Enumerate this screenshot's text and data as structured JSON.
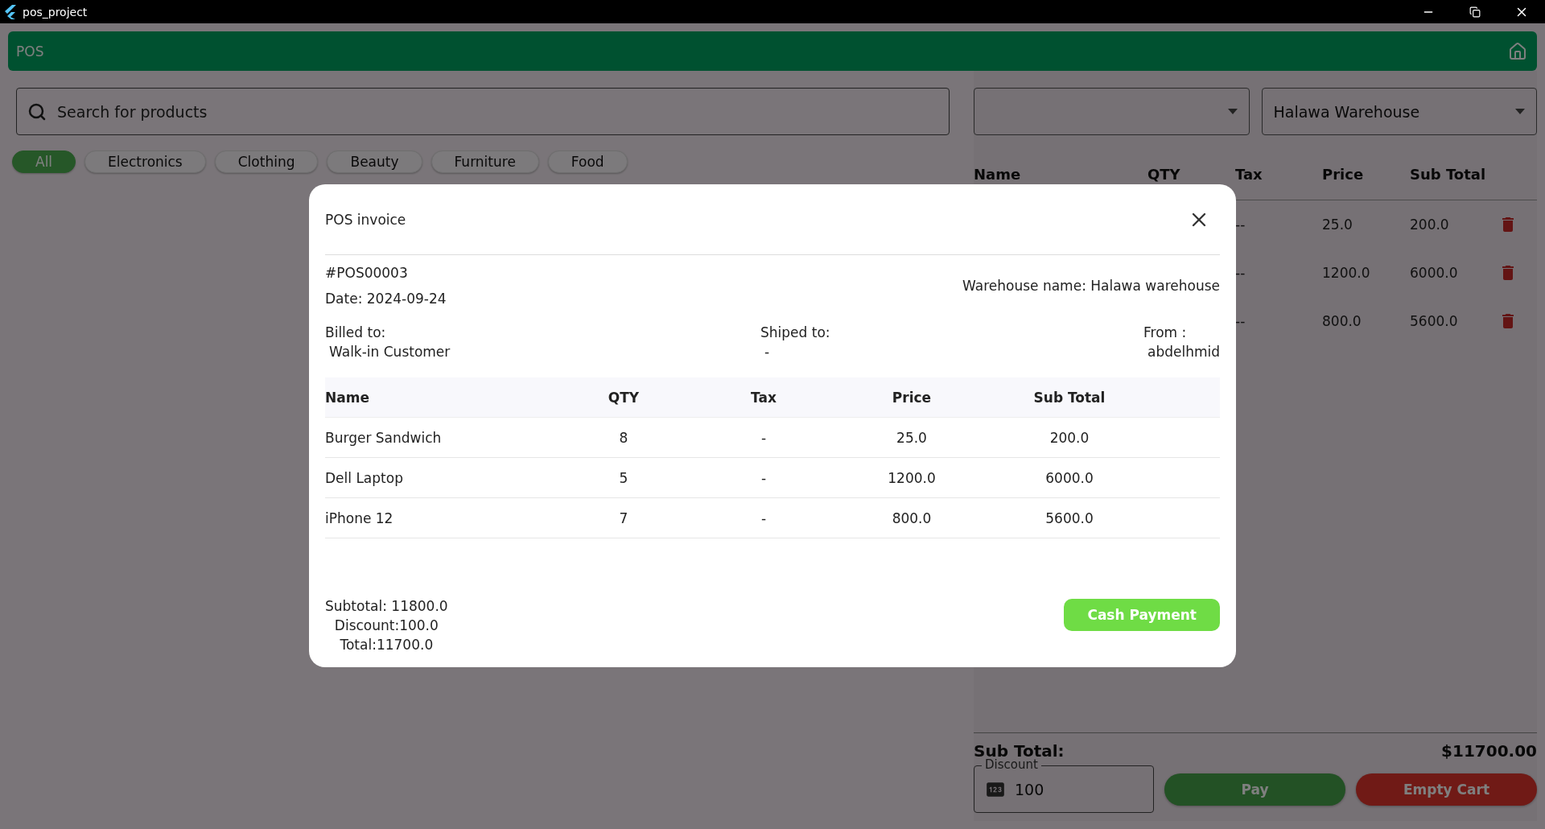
{
  "window": {
    "title": "pos_project"
  },
  "app_bar": {
    "title": "POS"
  },
  "search": {
    "placeholder": "Search for products"
  },
  "categories": [
    {
      "label": "All",
      "selected": true
    },
    {
      "label": "Electronics",
      "selected": false
    },
    {
      "label": "Clothing",
      "selected": false
    },
    {
      "label": "Beauty",
      "selected": false
    },
    {
      "label": "Furniture",
      "selected": false
    },
    {
      "label": "Food",
      "selected": false
    }
  ],
  "warehouse_select": {
    "value": "Halawa Warehouse"
  },
  "cart": {
    "columns": [
      "Name",
      "QTY",
      "Tax",
      "Price",
      "Sub Total"
    ],
    "rows": [
      {
        "tax": "--",
        "price": "25.0",
        "sub_total": "200.0"
      },
      {
        "tax": "--",
        "price": "1200.0",
        "sub_total": "6000.0"
      },
      {
        "tax": "--",
        "price": "800.0",
        "sub_total": "5600.0"
      }
    ]
  },
  "summary": {
    "label": "Sub Total:",
    "amount": "$11700.00",
    "discount_label": "Discount",
    "discount_value": "100"
  },
  "actions": [
    {
      "label": "Pay",
      "kind": "primary"
    },
    {
      "label": "Empty Cart",
      "kind": "danger"
    }
  ],
  "invoice": {
    "title": "POS invoice",
    "number": "#POS00003",
    "date": "Date: 2024-09-24",
    "warehouse": "Warehouse name: Halawa warehouse",
    "parties": [
      {
        "label": "Billed to:",
        "value": "Walk-in Customer"
      },
      {
        "label": "Shiped to:",
        "value": "-"
      },
      {
        "label": "From :",
        "value": "abdelhmid"
      }
    ],
    "columns": [
      "Name",
      "QTY",
      "Tax",
      "Price",
      "Sub Total"
    ],
    "rows": [
      {
        "name": "Burger Sandwich",
        "qty": "8",
        "tax": "-",
        "price": "25.0",
        "sub_total": "200.0"
      },
      {
        "name": "Dell Laptop",
        "qty": "5",
        "tax": "-",
        "price": "1200.0",
        "sub_total": "6000.0"
      },
      {
        "name": "iPhone 12",
        "qty": "7",
        "tax": "-",
        "price": "800.0",
        "sub_total": "5600.0"
      }
    ],
    "totals": [
      "Subtotal: 11800.0",
      "Discount:100.0",
      "Total:11700.0"
    ],
    "button": "Cash Payment"
  }
}
